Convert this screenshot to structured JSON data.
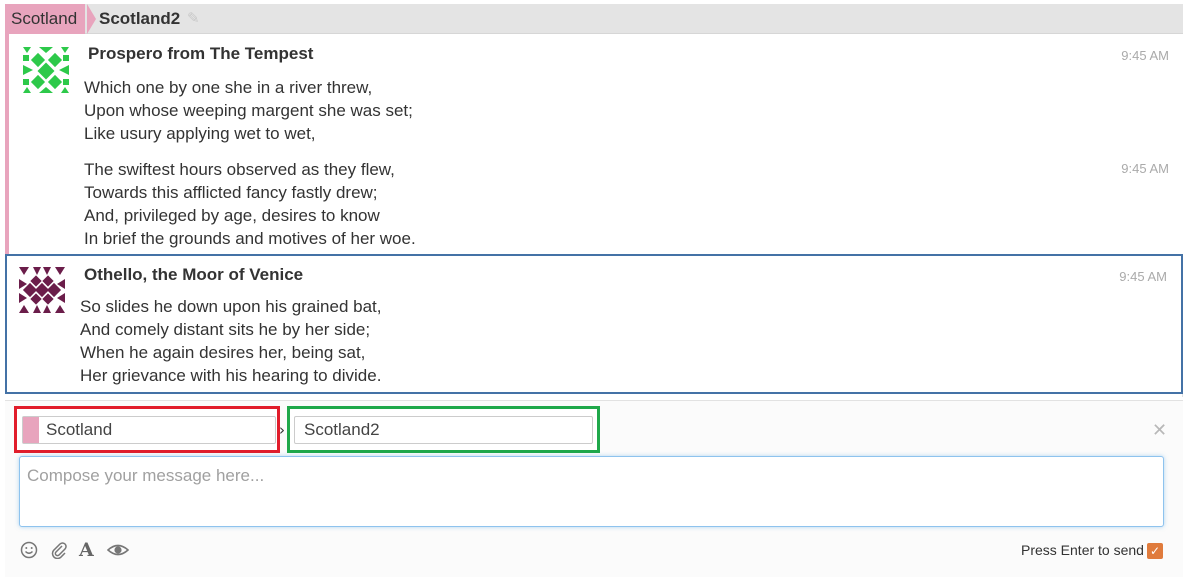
{
  "header": {
    "stream": "Scotland",
    "topic": "Scotland2",
    "stream_color": "#e8a4bd"
  },
  "messages": [
    {
      "sender": "Prospero from The Tempest",
      "avatar_color": "#2dc94a",
      "time": "9:45 AM",
      "lines": [
        "Which one by one she in a river threw,",
        "Upon whose weeping margent she was set;",
        "Like usury applying wet to wet,"
      ]
    },
    {
      "sender": "",
      "time": "9:45 AM",
      "lines": [
        "The swiftest hours observed as they flew,",
        "Towards this afflicted fancy fastly drew;",
        "And, privileged by age, desires to know",
        "In brief the grounds and motives of her woe."
      ]
    },
    {
      "sender": "Othello, the Moor of Venice",
      "avatar_color": "#6b1d4a",
      "time": "9:45 AM",
      "lines": [
        "So slides he down upon his grained bat,",
        "And comely distant sits he by her side;",
        "When he again desires her, being sat,",
        "Her grievance with his hearing to divide."
      ]
    }
  ],
  "compose": {
    "stream_value": "Scotland",
    "topic_value": "Scotland2",
    "placeholder": "Compose your message here...",
    "enter_to_send_label": "Press Enter to send",
    "enter_to_send_checked": true
  },
  "colors": {
    "stream_box_highlight": "#e11d2b",
    "topic_box_highlight": "#1fa84a",
    "selected_message_border": "#4472a6",
    "checkbox": "#e07b3c"
  }
}
